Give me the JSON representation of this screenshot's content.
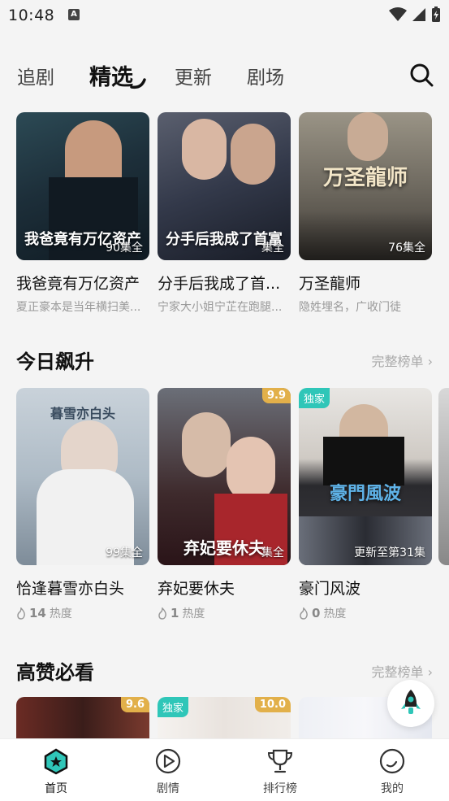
{
  "status": {
    "time": "10:48"
  },
  "tabs": [
    {
      "label": "追剧"
    },
    {
      "label": "精选"
    },
    {
      "label": "更新"
    },
    {
      "label": "剧场"
    }
  ],
  "featured": [
    {
      "poster_title": "我爸竟有万亿资产",
      "episodes": "90集全",
      "name": "我爸竟有万亿资产",
      "desc": "夏正豪本是当年横扫美..."
    },
    {
      "poster_title": "分手后我成了首富",
      "episodes": "集全",
      "name": "分手后我成了首...",
      "desc": "宁家大小姐宁芷在跑腿..."
    },
    {
      "poster_title": "万圣龍师",
      "episodes": "76集全",
      "name": "万圣龍师",
      "desc": "隐姓埋名，广收门徒"
    }
  ],
  "rising": {
    "title": "今日飙升",
    "more": "完整榜单",
    "items": [
      {
        "poster_title": "暮雪亦白头",
        "episodes": "99集全",
        "name": "恰逢暮雪亦白头",
        "heat": "14",
        "heat_label": "热度"
      },
      {
        "poster_title": "弃妃要休夫",
        "score": "9.9",
        "episodes": "集全",
        "name": "弃妃要休夫",
        "heat": "1",
        "heat_label": "热度"
      },
      {
        "poster_title": "豪門風波",
        "badge": "独家",
        "episodes": "更新至第31集",
        "name": "豪门风波",
        "heat": "0",
        "heat_label": "热度"
      }
    ]
  },
  "recommended": {
    "title": "高赞必看",
    "more": "完整榜单",
    "items": [
      {
        "score": "9.6"
      },
      {
        "badge": "独家",
        "score": "10.0"
      },
      {}
    ]
  },
  "nav": [
    {
      "label": "首页",
      "icon": "home-star-icon"
    },
    {
      "label": "剧情",
      "icon": "play-circle-icon"
    },
    {
      "label": "排行榜",
      "icon": "trophy-icon"
    },
    {
      "label": "我的",
      "icon": "profile-icon"
    }
  ],
  "colors": {
    "accent": "#2fc6b8",
    "score": "#e2b04a"
  }
}
